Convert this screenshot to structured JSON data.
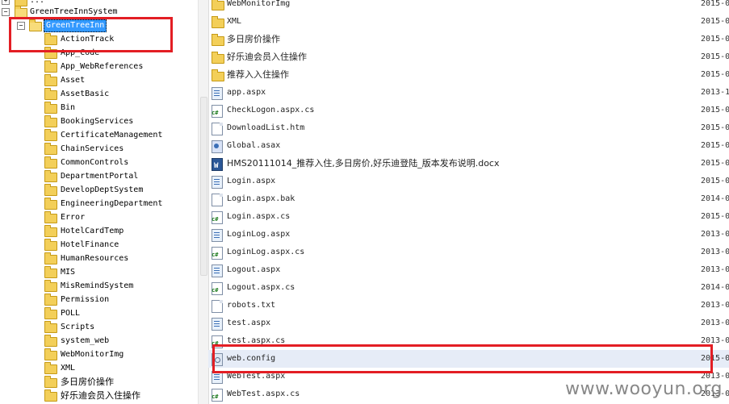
{
  "tree": {
    "top_partial": "...",
    "root": "GreenTreeInnSystem",
    "selected": "GreenTreeInn",
    "expander_symbol": "−",
    "children": [
      "ActionTrack",
      "App_Code",
      "App_WebReferences",
      "Asset",
      "AssetBasic",
      "Bin",
      "BookingServices",
      "CertificateManagement",
      "ChainServices",
      "CommonControls",
      "DepartmentPortal",
      "DevelopDeptSystem",
      "EngineeringDepartment",
      "Error",
      "HotelCardTemp",
      "HotelFinance",
      "HumanResources",
      "MIS",
      "MisRemindSystem",
      "Permission",
      "POLL",
      "Scripts",
      "system_web",
      "WebMonitorImg",
      "XML",
      "多日房价操作",
      "好乐迪会员入住操作"
    ]
  },
  "files": [
    {
      "name": "WebMonitorImg",
      "date": "2015-0",
      "icon": "folder"
    },
    {
      "name": "XML",
      "date": "2015-0",
      "icon": "folder"
    },
    {
      "name": "多日房价操作",
      "date": "2015-0",
      "icon": "folder"
    },
    {
      "name": "好乐迪会员入住操作",
      "date": "2015-0",
      "icon": "folder"
    },
    {
      "name": "推荐入入住操作",
      "date": "2015-0",
      "icon": "folder"
    },
    {
      "name": "app.aspx",
      "date": "2013-1",
      "icon": "aspx"
    },
    {
      "name": "CheckLogon.aspx.cs",
      "date": "2015-0",
      "icon": "cs"
    },
    {
      "name": "DownloadList.htm",
      "date": "2015-0",
      "icon": "plain"
    },
    {
      "name": "Global.asax",
      "date": "2015-0",
      "icon": "asax"
    },
    {
      "name": "HMS20111014_推荐入住,多日房价,好乐迪登陆_版本发布说明.docx",
      "date": "2015-0",
      "icon": "docx"
    },
    {
      "name": "Login.aspx",
      "date": "2015-0",
      "icon": "aspx"
    },
    {
      "name": "Login.aspx.bak",
      "date": "2014-0",
      "icon": "plain"
    },
    {
      "name": "Login.aspx.cs",
      "date": "2015-0",
      "icon": "cs"
    },
    {
      "name": "LoginLog.aspx",
      "date": "2013-0",
      "icon": "aspx"
    },
    {
      "name": "LoginLog.aspx.cs",
      "date": "2013-0",
      "icon": "cs"
    },
    {
      "name": "Logout.aspx",
      "date": "2013-0",
      "icon": "aspx"
    },
    {
      "name": "Logout.aspx.cs",
      "date": "2014-0",
      "icon": "cs"
    },
    {
      "name": "robots.txt",
      "date": "2013-0",
      "icon": "plain"
    },
    {
      "name": "test.aspx",
      "date": "2013-0",
      "icon": "aspx"
    },
    {
      "name": "test.aspx.cs",
      "date": "2013-0",
      "icon": "cs"
    },
    {
      "name": "web.config",
      "date": "2015-0",
      "icon": "config"
    },
    {
      "name": "WebTest.aspx",
      "date": "2013-0",
      "icon": "aspx"
    },
    {
      "name": "WebTest.aspx.cs",
      "date": "2013-0",
      "icon": "cs"
    }
  ],
  "highlight_color": "#e31e24",
  "watermark": "www.wooyun.org"
}
